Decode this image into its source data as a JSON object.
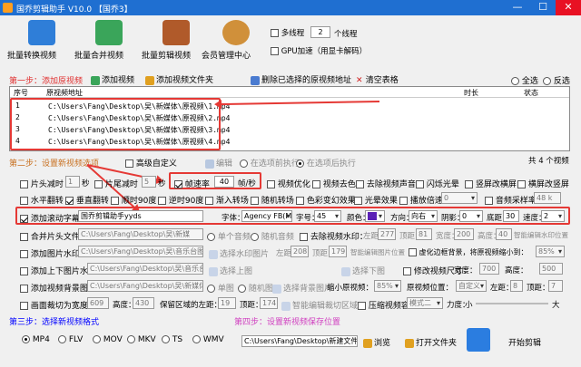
{
  "window": {
    "title": "国乔剪辑助手 V10.0   【国乔3】",
    "min": "—",
    "max": "☐",
    "close": "✕"
  },
  "toolbar": {
    "buttons": [
      {
        "label": "批量转换视频",
        "color": "#2f7ed8"
      },
      {
        "label": "批量合并视频",
        "color": "#3aa55a"
      },
      {
        "label": "批量剪辑视频",
        "color": "#b05a2a"
      },
      {
        "label": "会员管理中心",
        "color": "#d0903a"
      }
    ],
    "multithread_label": "多线程",
    "threads_value": "2",
    "threads_unit": "个线程",
    "gpu_label": "GPU加速（用显卡解码）"
  },
  "step1": {
    "title": "第一步：添加原视频",
    "add_video": "添加视频",
    "add_folder": "添加视频文件夹",
    "delete_selected": "删除已选择的原视频地址",
    "clear_table": "清空表格",
    "select_all": "全选",
    "invert": "反选"
  },
  "table": {
    "headers": {
      "index": "序号",
      "path": "原视频地址",
      "duration": "时长",
      "status": "状态"
    },
    "rows": [
      {
        "index": "1",
        "path": "C:\\Users\\Fang\\Desktop\\吴\\新媒体\\原视频\\1.mp4"
      },
      {
        "index": "2",
        "path": "C:\\Users\\Fang\\Desktop\\吴\\新媒体\\原视频\\2.mp4"
      },
      {
        "index": "3",
        "path": "C:\\Users\\Fang\\Desktop\\吴\\新媒体\\原视频\\3.mp4"
      },
      {
        "index": "4",
        "path": "C:\\Users\\Fang\\Desktop\\吴\\新媒体\\原视频\\4.mp4"
      }
    ],
    "count": "共 4 个视频"
  },
  "step2": {
    "title": "第二步：设置新视频选项",
    "advanced": "高级自定义",
    "edit": "编辑",
    "before_merge": "在选项前执行",
    "after_merge": "在选项后执行"
  },
  "opts": {
    "trim_head": "片头减时",
    "trim_head_val": "1",
    "sec": "秒",
    "trim_tail": "片尾减时",
    "trim_tail_val": "5",
    "framerate": "帧速率",
    "framerate_val": "40",
    "framerate_unit": "帧/秒",
    "optimize": "视频优化",
    "deblack": "视频去色",
    "remove_audio": "去除视频声音",
    "flash": "闪烁光晕",
    "v2h": "竖屏改横屏",
    "h2v": "横屏改竖屏",
    "hflip": "水平翻转",
    "vflip": "垂直翻转",
    "cw90": "顺时90度",
    "ccw90": "逆时90度",
    "fadein": "渐入转场",
    "fadeout": "随机转场",
    "color": "色彩变幻效果",
    "light": "光晕效果",
    "speed": "播放倍速",
    "speed_val": "0",
    "sample": "音频采样率",
    "sample_val": "48 k",
    "subtitle": "添加滚动字幕：",
    "subtitle_text": "国乔剪辑助手yyds",
    "font_lbl": "字体：",
    "font_val": "Agency FB(M)",
    "size_lbl": "字号：",
    "size_val": "45",
    "color_lbl": "颜色：",
    "dir_lbl": "方向：",
    "dir_val": "向右",
    "shadow_lbl": "阴影：",
    "shadow_val": "0",
    "bottom_lbl": "底距：",
    "bottom_val": "30",
    "speed_lbl": "速度：",
    "speed2_val": "2",
    "cover_head": "合并片头文件：",
    "cover_path": "C:\\Users\\Fang\\Desktop\\吴\\新媒",
    "single_audio": "单个音频",
    "random_audio": "随机音频",
    "remove_wm": "去除视频水印：",
    "left": "左距：",
    "left_val": "277",
    "top": "顶距：",
    "top_val": "81",
    "width": "宽度：",
    "width_val": "200",
    "height": "高度：",
    "height_val": "40",
    "smart_wm": "智能编辑水印位置",
    "add_pic": "添加图片水印：",
    "pic_path": "C:\\Users\\Fang\\Desktop\\吴\\音乐台图片",
    "choose_wm": "选择水印图片",
    "pic_left": "208",
    "pic_top": "179",
    "smart_pic": "智能编辑图片位置",
    "blur_bg": "虚化边框背景，将原视频缩小到：",
    "blur_val": "85%",
    "add_topbot": "添加上下图片水印：",
    "topbot_path": "C:\\Users\\Fang\\Desktop\\吴\\音乐台",
    "choose_top": "选择上图",
    "choose_bottom": "选择下图",
    "resize": "修改视频尺寸：",
    "resize_w_lbl": "宽度：",
    "resize_w": "700",
    "resize_h_lbl": "高度：",
    "resize_h": "500",
    "add_bg": "添加视频背景图片：",
    "bg_path": "C:\\Users\\Fang\\Desktop\\吴\\新媒体",
    "single_pic": "单图",
    "random_pic": "随机图",
    "choose_bg": "选择背景图片",
    "shrink": "缩小原视频：",
    "shrink_val": "85%",
    "shrink_pos": "原视频位置：",
    "shrink_pos_val": "自定义",
    "pos_left": "左距：",
    "pos_left_val": "8",
    "pos_top": "顶距：",
    "pos_top_val": "7",
    "crop": "画面裁切为宽度：",
    "crop_w": "609",
    "crop_h_lbl": "高度：",
    "crop_h": "430",
    "keep_left": "保留区域的左距：",
    "keep_left_val": "19",
    "keep_top": "顶距：",
    "keep_top_val": "174",
    "smart_crop": "智能编辑裁切区域",
    "compress": "压缩视频容量",
    "mode": "模式二",
    "strength": "力度：",
    "small": "小",
    "big": "大"
  },
  "step3": {
    "title": "第三步：选择新视频格式",
    "formats": [
      "MP4",
      "FLV",
      "MOV",
      "MKV",
      "TS",
      "WMV"
    ]
  },
  "step4": {
    "title": "第四步：设置新视频保存位置",
    "path": "C:\\Users\\Fang\\Desktop\\新建文件夹",
    "browse": "浏览",
    "open": "打开文件夹",
    "start": "开始剪辑"
  },
  "colors": {
    "accent": "#1f6fd1",
    "highlight": "#e53935",
    "subtitle_color": "#5b21b6"
  }
}
